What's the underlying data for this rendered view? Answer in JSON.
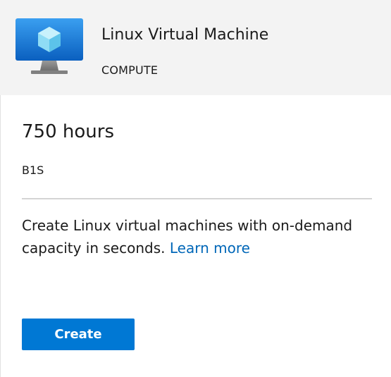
{
  "card": {
    "title": "Linux Virtual Machine",
    "category": "COMPUTE",
    "amount": "750 hours",
    "sku": "B1S",
    "description": "Create Linux virtual machines with on-demand capacity in seconds.",
    "learn_more_label": "Learn more",
    "create_label": "Create",
    "icon": "virtual-machine-icon",
    "colors": {
      "accent": "#0078d4",
      "link": "#0067b8",
      "header_bg": "#f3f3f3"
    }
  }
}
